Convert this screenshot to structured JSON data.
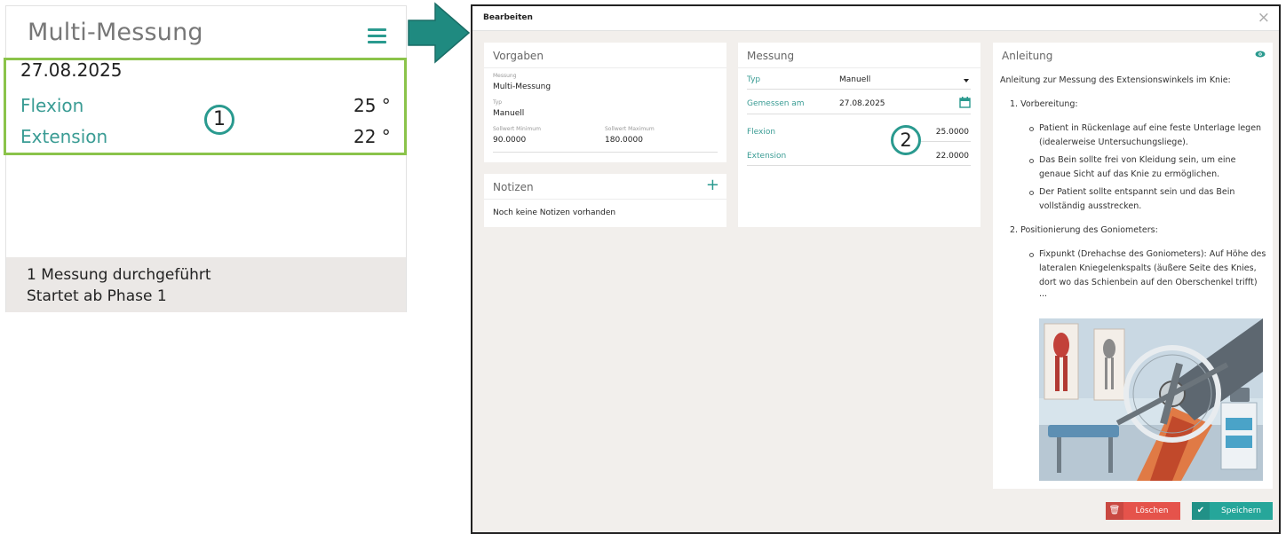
{
  "left_card": {
    "title": "Multi-Messung",
    "date": "27.08.2025",
    "rows": [
      {
        "label": "Flexion",
        "value": "25 °"
      },
      {
        "label": "Extension",
        "value": "22 °"
      }
    ],
    "badge": "1",
    "footer_line1": "1 Messung durchgeführt",
    "footer_line2": "Startet ab Phase 1"
  },
  "dialog": {
    "title": "Bearbeiten",
    "close": "×",
    "vorgaben": {
      "title": "Vorgaben",
      "messung_label": "Messung",
      "messung_value": "Multi-Messung",
      "typ_label": "Typ",
      "typ_value": "Manuell",
      "min_label": "Sollwert Minimum",
      "min_value": "90.0000",
      "max_label": "Sollwert Maximum",
      "max_value": "180.0000"
    },
    "notizen": {
      "title": "Notizen",
      "add": "+",
      "empty": "Noch keine Notizen vorhanden"
    },
    "messung": {
      "title": "Messung",
      "typ_label": "Typ",
      "typ_value": "Manuell",
      "gemessen_label": "Gemessen am",
      "gemessen_value": "27.08.2025",
      "flexion_label": "Flexion",
      "flexion_value": "25.0000",
      "extension_label": "Extension",
      "extension_value": "22.0000",
      "badge": "2"
    },
    "anleitung": {
      "title": "Anleitung",
      "intro": "Anleitung zur Messung des Extensionswinkels im Knie:",
      "step1": "1. Vorbereitung:",
      "b1": "Patient in Rückenlage auf eine feste Unterlage legen (idealerweise Untersuchungsliege).",
      "b2": "Das Bein sollte frei von Kleidung sein, um eine genaue Sicht auf das Knie zu ermöglichen.",
      "b3": "Der Patient sollte entspannt sein und das Bein vollständig ausstrecken.",
      "step2": "2. Positionierung des Goniometers:",
      "b4": "Fixpunkt (Drehachse des Goniometers): Auf Höhe des lateralen Kniegelenkspalts (äußere Seite des Knies, dort wo das Schienbein auf den Oberschenkel trifft)",
      "ellipsis": "..."
    },
    "buttons": {
      "delete": "Löschen",
      "save": "Speichern"
    }
  },
  "colors": {
    "accent": "#2a9a8f",
    "highlight_box": "#8bc34a",
    "delete": "#e5534b",
    "save": "#26a69a"
  }
}
